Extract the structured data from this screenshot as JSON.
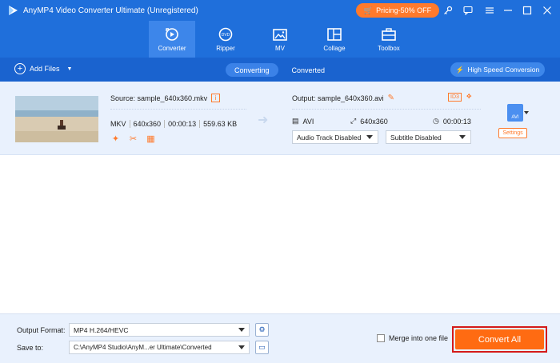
{
  "app": {
    "title": "AnyMP4 Video Converter Ultimate (Unregistered)"
  },
  "promo": {
    "label": "Pricing-50% OFF"
  },
  "window_controls": [
    "key-icon",
    "chat-icon",
    "menu-icon",
    "minimize-icon",
    "maximize-icon",
    "close-icon"
  ],
  "nav": {
    "items": [
      {
        "label": "Converter",
        "icon": "converter-icon",
        "active": true
      },
      {
        "label": "Ripper",
        "icon": "ripper-icon",
        "active": false
      },
      {
        "label": "MV",
        "icon": "mv-icon",
        "active": false
      },
      {
        "label": "Collage",
        "icon": "collage-icon",
        "active": false
      },
      {
        "label": "Toolbox",
        "icon": "toolbox-icon",
        "active": false
      }
    ]
  },
  "toolbar": {
    "add_files": "Add Files",
    "tabs": [
      "Converting",
      "Converted"
    ],
    "active_tab": "Converting",
    "high_speed": "High Speed Conversion"
  },
  "file": {
    "source_label": "Source: sample_640x360.mkv",
    "format": "MKV",
    "resolution": "640x360",
    "duration": "00:00:13",
    "size": "559.63 KB",
    "output_label": "Output: sample_640x360.avi",
    "out_format": "AVI",
    "out_resolution": "640x360",
    "out_duration": "00:00:13",
    "audio_track": "Audio Track Disabled",
    "subtitle": "Subtitle Disabled",
    "settings_label": "Settings",
    "badge_id": "ID3"
  },
  "bottom": {
    "output_format_label": "Output Format:",
    "output_format_value": "MP4 H.264/HEVC",
    "save_to_label": "Save to:",
    "save_to_value": "C:\\AnyMP4 Studio\\AnyM...er Ultimate\\Converted",
    "merge_label": "Merge into one file",
    "merge_checked": false,
    "convert_all": "Convert All"
  },
  "colors": {
    "primary": "#1f6fdb",
    "accent": "#ff7a2c",
    "panel": "#e9f1fd"
  }
}
